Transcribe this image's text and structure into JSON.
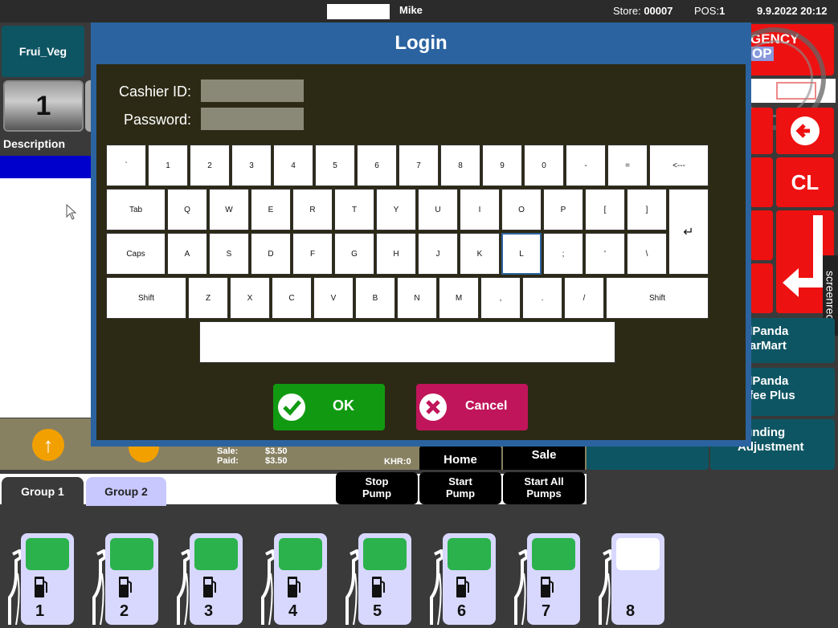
{
  "topbar": {
    "user": "Mike",
    "store_label": "Store:",
    "store": "00007",
    "pos_label": "POS:",
    "pos": "1",
    "datetime": "9.9.2022 20:12"
  },
  "left": {
    "category": "Frui_Veg",
    "page": "1",
    "description_header": "Description"
  },
  "status": {
    "sale_label": "Sale:",
    "paid_label": "Paid:",
    "sale": "$3.50",
    "paid": "$3.50",
    "khr": "KHR:0"
  },
  "actions": {
    "home": "Home",
    "sale": "Sale"
  },
  "right": {
    "emergency_l1": "GENCY",
    "emergency_l2": "OP",
    "cl": "CL",
    "fp1_l1": "odPanda",
    "fp1_l2": "StarMart",
    "fp2_l1": "odPanda",
    "fp2_l2": "offee Plus",
    "round_l1": "ounding",
    "round_l2": "Adjustment",
    "screenrec": "screenrec"
  },
  "groups": {
    "group1": "Group 1",
    "group2": "Group 2"
  },
  "pump_actions": {
    "stop_l1": "Stop",
    "stop_l2": "Pump",
    "start_l1": "Start",
    "start_l2": "Pump",
    "startall_l1": "Start All",
    "startall_l2": "Pumps"
  },
  "pumps": [
    "1",
    "2",
    "3",
    "4",
    "5",
    "6",
    "7",
    "8"
  ],
  "modal": {
    "title": "Login",
    "cashier_label": "Cashier ID:",
    "password_label": "Password:",
    "cashier_value": "",
    "password_value": "",
    "ok": "OK",
    "cancel": "Cancel"
  },
  "keyboard": {
    "row1": [
      "`",
      "1",
      "2",
      "3",
      "4",
      "5",
      "6",
      "7",
      "8",
      "9",
      "0",
      "-",
      "=",
      "<---"
    ],
    "row2": [
      "Tab",
      "Q",
      "W",
      "E",
      "R",
      "T",
      "Y",
      "U",
      "I",
      "O",
      "P",
      "[",
      "]"
    ],
    "row3": [
      "Caps",
      "A",
      "S",
      "D",
      "F",
      "G",
      "H",
      "J",
      "K",
      "L",
      ";",
      "'",
      "\\"
    ],
    "row4": [
      "Shift",
      "Z",
      "X",
      "C",
      "V",
      "B",
      "N",
      "M",
      ",",
      ".",
      "/",
      "Shift"
    ],
    "enter": "↵",
    "focused_key": "L"
  },
  "colors": {
    "ok": "#119a11",
    "cancel": "#c0155a",
    "modal": "#2b63a0",
    "emergency": "#ee1111",
    "pump_active": "#2bb24c"
  }
}
